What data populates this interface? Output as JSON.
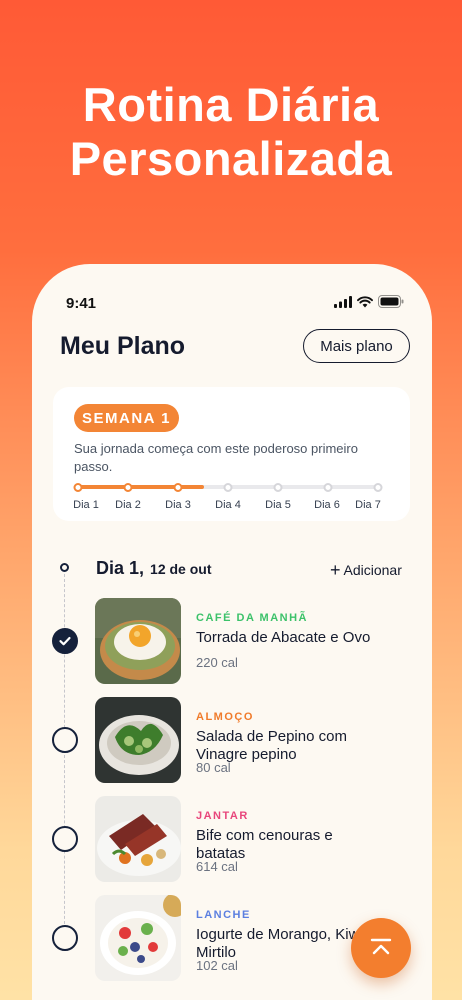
{
  "headline": {
    "line1": "Rotina Diária",
    "line2": "Personalizada"
  },
  "status_bar": {
    "time": "9:41"
  },
  "header": {
    "title": "Meu Plano",
    "more_plan_label": "Mais plano"
  },
  "week": {
    "badge": "SEMANA 1",
    "description": "Sua jornada começa com este poderoso primeiro passo.",
    "progress": 0.42,
    "days": [
      "Dia 1",
      "Dia 2",
      "Dia 3",
      "Dia 4",
      "Dia 5",
      "Dia 6",
      "Dia 7"
    ],
    "completed_days": 3
  },
  "day": {
    "title": "Dia 1,",
    "date": "12 de out",
    "add_label": "Adicionar"
  },
  "meals": [
    {
      "type": "CAFÉ DA MANHÃ",
      "type_color": "#3cc26a",
      "name": "Torrada de Abacate e Ovo",
      "calories": "220 cal",
      "done": true
    },
    {
      "type": "ALMOÇO",
      "type_color": "#f07b2b",
      "name": "Salada de Pepino com Vinagre pepino",
      "name_line1": "Salada de Pepino com",
      "name_line2": "Vinagre pepino",
      "calories": "80 cal",
      "done": false
    },
    {
      "type": "JANTAR",
      "type_color": "#e8467c",
      "name": "Bife com cenouras e batatas",
      "name_line1": "Bife com cenouras e",
      "name_line2": "batatas",
      "calories": "614 cal",
      "done": false
    },
    {
      "type": "LANCHE",
      "type_color": "#5b7fe0",
      "name": "Iogurte de Morango, Kiwi, Mirtilo",
      "name_line1": "Iogurte de Morango, Kiwi,",
      "name_line2": "Mirtilo",
      "calories": "102 cal",
      "done": false
    }
  ],
  "icons": {
    "signal": "signal-icon",
    "wifi": "wifi-icon",
    "battery": "battery-icon",
    "check": "checkmark-icon",
    "plus": "plus-icon",
    "fab": "scroll-to-top-icon"
  },
  "colors": {
    "accent": "#f38535",
    "navy": "#15213b"
  }
}
